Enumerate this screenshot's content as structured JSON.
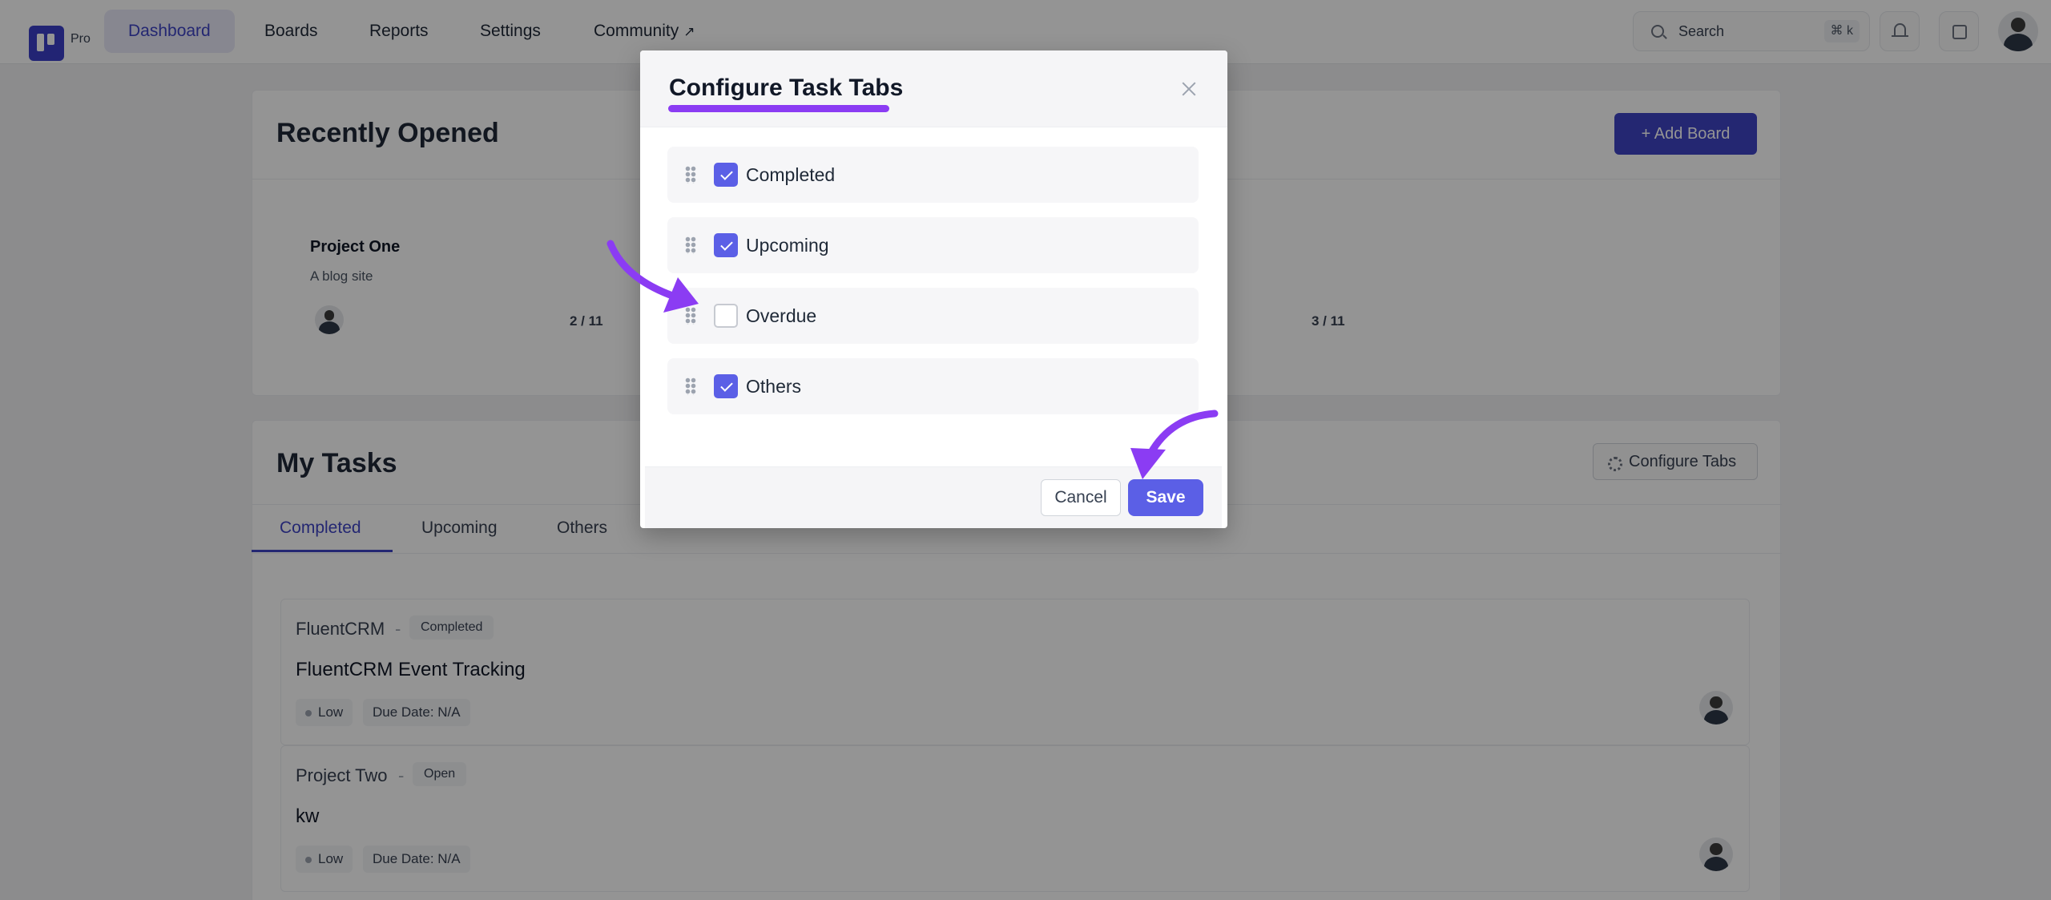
{
  "nav": {
    "logo_suffix": "Pro",
    "items": [
      "Dashboard",
      "Boards",
      "Reports",
      "Settings",
      "Community"
    ],
    "external_arrow": "↗",
    "search_placeholder": "Search",
    "search_shortcut": "⌘ k"
  },
  "recent": {
    "title": "Recently Opened",
    "add_board_label": "+ Add Board",
    "projects": [
      {
        "name": "Project One",
        "description": "A blog site",
        "count": "2 / 11"
      },
      {
        "count": "3 / 11"
      }
    ]
  },
  "my_tasks": {
    "title": "My Tasks",
    "configure_label": "Configure Tabs",
    "tabs": [
      "Completed",
      "Upcoming",
      "Others"
    ],
    "active_tab": "Completed",
    "tasks": [
      {
        "project": "FluentCRM",
        "separator": "-",
        "status": "Completed",
        "title": "FluentCRM Event Tracking",
        "priority": "Low",
        "due_label": "Due Date:",
        "due_value": "N/A"
      },
      {
        "project": "Project Two",
        "separator": "-",
        "status": "Open",
        "title": "kw",
        "priority": "Low",
        "due_label": "Due Date:",
        "due_value": "N/A"
      }
    ]
  },
  "modal": {
    "title": "Configure Task Tabs",
    "rows": [
      {
        "label": "Completed",
        "checked": true
      },
      {
        "label": "Upcoming",
        "checked": true
      },
      {
        "label": "Overdue",
        "checked": false
      },
      {
        "label": "Others",
        "checked": true
      }
    ],
    "cancel_label": "Cancel",
    "save_label": "Save"
  },
  "colors": {
    "accent": "#3f44c4",
    "checkbox": "#5b5fe6",
    "annotation": "#8b3cf3"
  }
}
